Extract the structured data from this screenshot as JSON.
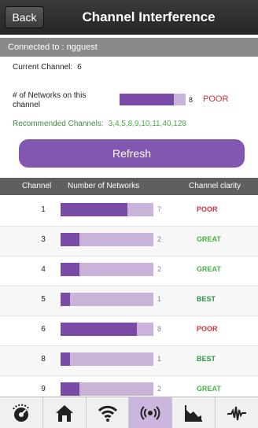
{
  "header": {
    "back_label": "Back",
    "title": "Channel Interference"
  },
  "connection": {
    "text": "Connected to : ngguest"
  },
  "current": {
    "label": "Current Channel:",
    "channel": "6",
    "networks_label": "# of Networks on this channel",
    "networks_count": "8",
    "networks_fill": 0.82,
    "status": "POOR",
    "recommended_label": "Recommended Channels:",
    "recommended_values": "3,4,5,8,9,10,11,40,128"
  },
  "refresh_label": "Refresh",
  "table": {
    "headers": [
      "Channel",
      "Number of Networks",
      "Channel clarity"
    ],
    "rows": [
      {
        "channel": "1",
        "count": "7",
        "fill": 0.72,
        "status": "POOR",
        "status_color": "#d0323a"
      },
      {
        "channel": "3",
        "count": "2",
        "fill": 0.2,
        "status": "GREAT",
        "status_color": "#48b048"
      },
      {
        "channel": "4",
        "count": "2",
        "fill": 0.2,
        "status": "GREAT",
        "status_color": "#48b048"
      },
      {
        "channel": "5",
        "count": "1",
        "fill": 0.1,
        "status": "BEST",
        "status_color": "#2a9a44"
      },
      {
        "channel": "6",
        "count": "8",
        "fill": 0.82,
        "status": "POOR",
        "status_color": "#d0323a"
      },
      {
        "channel": "8",
        "count": "1",
        "fill": 0.1,
        "status": "BEST",
        "status_color": "#2a9a44"
      },
      {
        "channel": "9",
        "count": "2",
        "fill": 0.2,
        "status": "GREAT",
        "status_color": "#48b048"
      }
    ]
  },
  "tabs": [
    {
      "icon": "speed-meter-icon"
    },
    {
      "icon": "home-icon"
    },
    {
      "icon": "wifi-icon"
    },
    {
      "icon": "channel-interference-icon",
      "active": true
    },
    {
      "icon": "area-chart-icon"
    },
    {
      "icon": "signal-wave-icon"
    }
  ],
  "colors": {
    "accent": "#8157b0",
    "bar_fill": "#7a4ba6",
    "bar_track": "#c9b3d8"
  }
}
